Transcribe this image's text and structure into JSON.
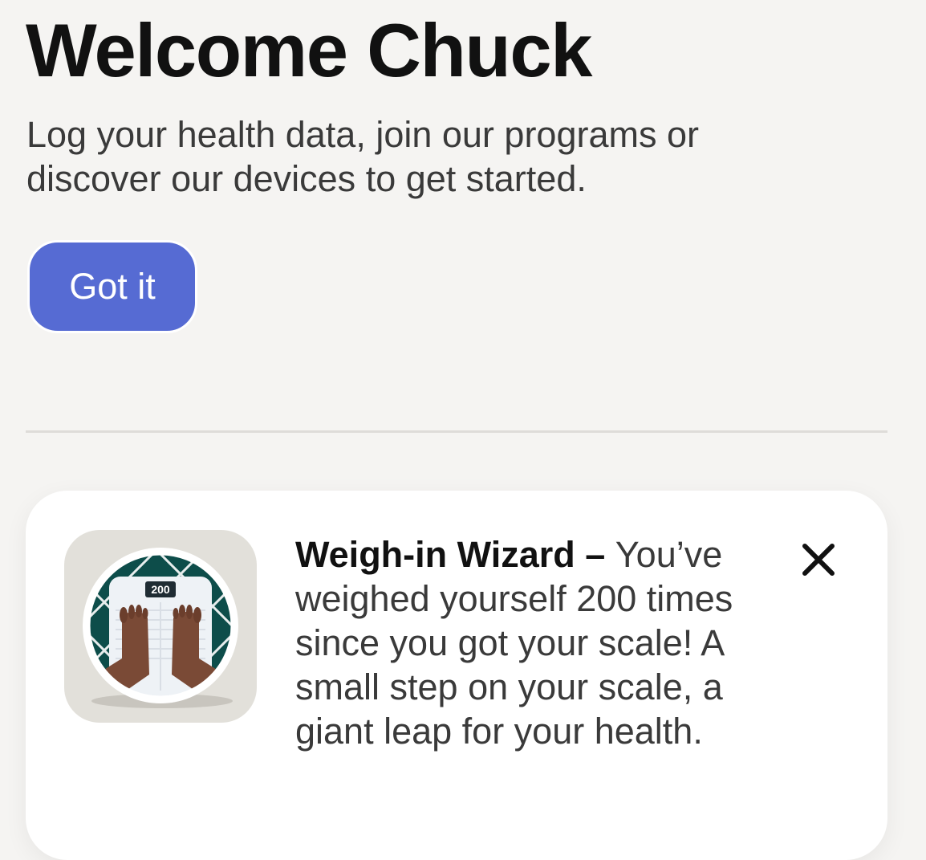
{
  "header": {
    "title": "Welcome Chuck",
    "subtitle": "Log your health data, join our programs or discover our devices to get started."
  },
  "actions": {
    "got_it_label": "Got it"
  },
  "achievement_card": {
    "badge_name": "Weigh-in Wizard",
    "separator": " – ",
    "message": "You’ve weighed yourself 200 times since you got your scale! A small step on your scale, a giant leap for your health.",
    "scale_display": "200",
    "badge_icon": "scale-feet-icon",
    "close_icon": "close-icon"
  },
  "colors": {
    "background": "#f5f4f2",
    "accent_button": "#566bd3",
    "badge_circle": "#0d4d4a",
    "card": "#ffffff"
  }
}
